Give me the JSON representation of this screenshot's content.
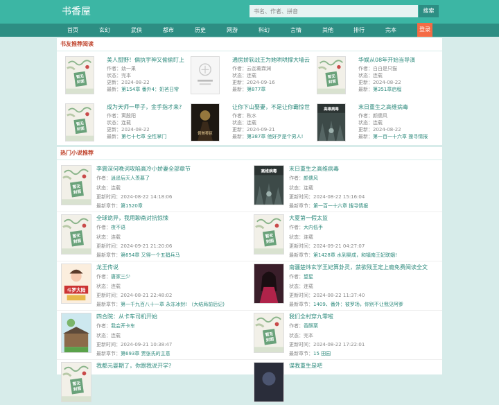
{
  "header": {
    "logo": "书香屋",
    "search_placeholder": "书名、作者、拼音",
    "search_button": "搜索"
  },
  "nav": {
    "items": [
      "首页",
      "玄幻",
      "武侠",
      "都市",
      "历史",
      "网游",
      "科幻",
      "言情",
      "其他",
      "排行",
      "完本"
    ],
    "login": "登录"
  },
  "recommend": {
    "title": "书友推荐阅读",
    "books": [
      {
        "title": "美人甜野！偏执宇神又偷偷盯上",
        "author": "作者：幼一果",
        "status": "状态：完本",
        "updated": "更新：2024-08-22",
        "latest_label": "最新：",
        "latest": "第154章 番外4：奶爸日常",
        "cover": "generic"
      },
      {
        "title": "通房娇软战王为她哄哄撑大墙云",
        "author": "作者：云惢薰霖渊",
        "status": "状态：连载",
        "updated": "更新：2024-09-16",
        "latest_label": "最新：",
        "latest": "第877章",
        "cover": "missing"
      },
      {
        "title": "华娱从08年开始当导演",
        "author": "作者：白白是只猫",
        "status": "状态：连载",
        "updated": "更新：2024-08-22",
        "latest_label": "最新：",
        "latest": "第351章启程",
        "cover": "generic"
      },
      {
        "title": "成为天师一甲子，金手指才来?",
        "author": "作者：寓殷阳",
        "status": "状态：连载",
        "updated": "更新：2024-08-22",
        "latest_label": "最新：",
        "latest": "第七十七章 全性掌门",
        "cover": "generic"
      },
      {
        "title": "让你下山娶妻，不是让你霸惊世",
        "author": "作者：秋水",
        "status": "状态：连载",
        "updated": "更新：2024-09-21",
        "latest_label": "最新：",
        "latest": "第387章 他好歹是个男人!",
        "cover": "dark",
        "cover_text": "俯首称臣"
      },
      {
        "title": "末日重生之高维病毒",
        "author": "作者：颜儒风",
        "status": "状态：连载",
        "updated": "更新：2024-08-22",
        "latest_label": "最新：",
        "latest": "第一百一十六章 搜寻情报",
        "cover": "virus",
        "cover_text": "高维病毒"
      }
    ]
  },
  "hot": {
    "title": "热门小说推荐",
    "books": [
      {
        "title": "李震深何晚词攻陷高冷小娇妻全部章节",
        "author_label": "作者：",
        "author": "逍遥后天人羡慕了",
        "status": "状态：连载",
        "updated": "更新时间：2024-08-22 14:18:06",
        "latest_label": "最新章节：",
        "latest": "第1520章",
        "cover": "generic"
      },
      {
        "title": "末日重生之高维病毒",
        "author_label": "作者：",
        "author": "颜儒风",
        "status": "状态：连载",
        "updated": "更新时间：2024-08-22 15:16:04",
        "latest_label": "最新章节：",
        "latest": "第一百一十六章 搜寻情报",
        "cover": "virus",
        "cover_text": "高维病毒"
      },
      {
        "title": "全球诡异，我用聊斋对抗惊悚",
        "author_label": "作者：",
        "author": "夜不语",
        "status": "状态：连载",
        "updated": "更新时间：2024-09-21 21:20:06",
        "latest_label": "最新章节：",
        "latest": "第654章 又得一个五猖兵马",
        "cover": "generic"
      },
      {
        "title": "大夏第一假太监",
        "author_label": "作者：",
        "author": "大内低手",
        "status": "状态：连载",
        "updated": "更新时间：2024-09-21 04:27:07",
        "latest_label": "最新章节：",
        "latest": "第1428章 水到渠成，和镇南王妃联姻!",
        "cover": "generic"
      },
      {
        "title": "龙王传说",
        "author_label": "作者：",
        "author": "唐家三少",
        "status": "状态：连载",
        "updated": "更新时间：2024-08-21 22:48:02",
        "latest_label": "最新章节：",
        "latest": "第一千九百八十一章 永冻冰封! （大结局前后记)",
        "cover": "anime",
        "cover_text": "斗罗大陆"
      },
      {
        "title": "南疆楚炜玄学王妃算卦灵，禁欲残王定上瘾免费阅读全文",
        "author_label": "作者：",
        "author": "望星",
        "status": "状态：连载",
        "updated": "更新时间：2024-08-22 11:37:40",
        "latest_label": "最新章节：",
        "latest": "1409、番外：彼罗场，你别不让我见阿爹",
        "cover": "romance"
      },
      {
        "title": "四合院：从卡车司机开始",
        "author_label": "作者：",
        "author": "我会开卡车",
        "status": "状态：连载",
        "updated": "更新时间：2024-09-21 10:38:47",
        "latest_label": "最新章节：",
        "latest": "第693章 贾张氏的主意",
        "cover": "courtyard"
      },
      {
        "title": "我们全村穿九零啦",
        "author_label": "作者：",
        "author": "香酥栗",
        "status": "状态：完本",
        "updated": "更新时间：2024-08-22 17:22:01",
        "latest_label": "最新章节：",
        "latest": "15 田园",
        "cover": "generic"
      },
      {
        "title": "我都元婴期了，你跟我说开学?",
        "author_label": "",
        "author": "",
        "status": "",
        "updated": "",
        "latest_label": "",
        "latest": "",
        "cover": "generic"
      },
      {
        "title": "谍我重生是吧",
        "author_label": "",
        "author": "",
        "status": "",
        "updated": "",
        "latest_label": "",
        "latest": "",
        "cover": "dark2"
      }
    ]
  },
  "cover_generic_text": "暂无封面",
  "colors": {
    "header": "#3cb6a4",
    "nav": "#2d8e83",
    "login": "#f46b45",
    "title_red": "#c0452e",
    "link": "#2c8a7c"
  }
}
